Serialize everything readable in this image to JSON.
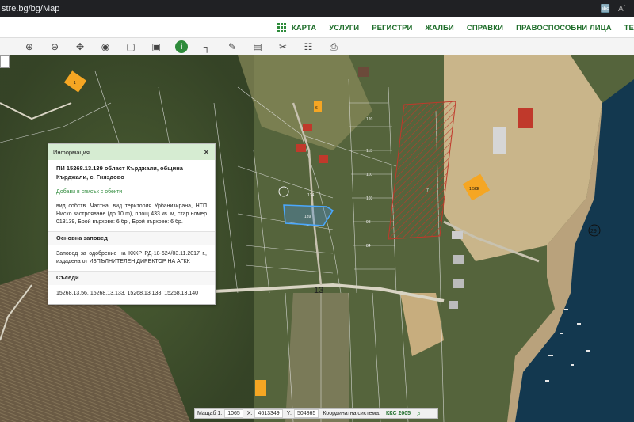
{
  "browser": {
    "url": "stre.bg/bg/Map",
    "icons": [
      "translate-icon",
      "reader-icon"
    ]
  },
  "header": {
    "nav": [
      "КАРТА",
      "УСЛУГИ",
      "РЕГИСТРИ",
      "ЖАЛБИ",
      "СПРАВКИ",
      "ПРАВОСПОСОБНИ ЛИЦА",
      "ТЕ"
    ]
  },
  "toolbar": {
    "tools": [
      "zoom-in-icon",
      "zoom-out-icon",
      "pan-icon",
      "pin-icon",
      "select-rect-icon",
      "measure-icon",
      "info-icon",
      "corner-icon",
      "draw-icon",
      "layers-icon",
      "split-icon",
      "document-icon",
      "print-icon"
    ]
  },
  "map": {
    "road_label": "13",
    "lake_label": "29",
    "parcel_numbers": [
      "139",
      "134",
      "120",
      "113",
      "110",
      "103",
      "93",
      "84",
      "7"
    ],
    "building_labels": [
      "6",
      "1",
      "1 5КЕ"
    ],
    "colors": {
      "selected_parcel": "#4a8fd8",
      "hatched_parcel": "#c0392b",
      "water": "#13384f",
      "building": "#f5a623"
    }
  },
  "popup": {
    "title": "Информация",
    "parcel": "ПИ 15268.13.139 област Кърджали, община Кърджали, с. Гняздово",
    "add_link": "Добави в списък с обекти",
    "description": "вид собств. Частна, вид територия Урбанизирана, НТП Ниско застрояване (до 10 m), площ 433 кв. м, стар номер 013139, Брой върхове: 6 бр., Брой върхове: 6 бр.",
    "order_heading": "Основна заповед",
    "order_text": "Заповед за одобрение на КККР РД-18-624/03.11.2017 г., издадена от ИЗПЪЛНИТЕЛЕН ДИРЕКТОР НА АГКК",
    "neighbors_heading": "Съседи",
    "neighbors": "15268.13.56, 15268.13.133, 15268.13.138, 15268.13.140"
  },
  "status": {
    "scale_label": "Мащаб 1:",
    "scale_value": "1065",
    "x_label": "X:",
    "x_value": "4613349",
    "y_label": "Y:",
    "y_value": "504865",
    "crs_label": "Координатна система:",
    "crs_value": "ККС 2005"
  }
}
